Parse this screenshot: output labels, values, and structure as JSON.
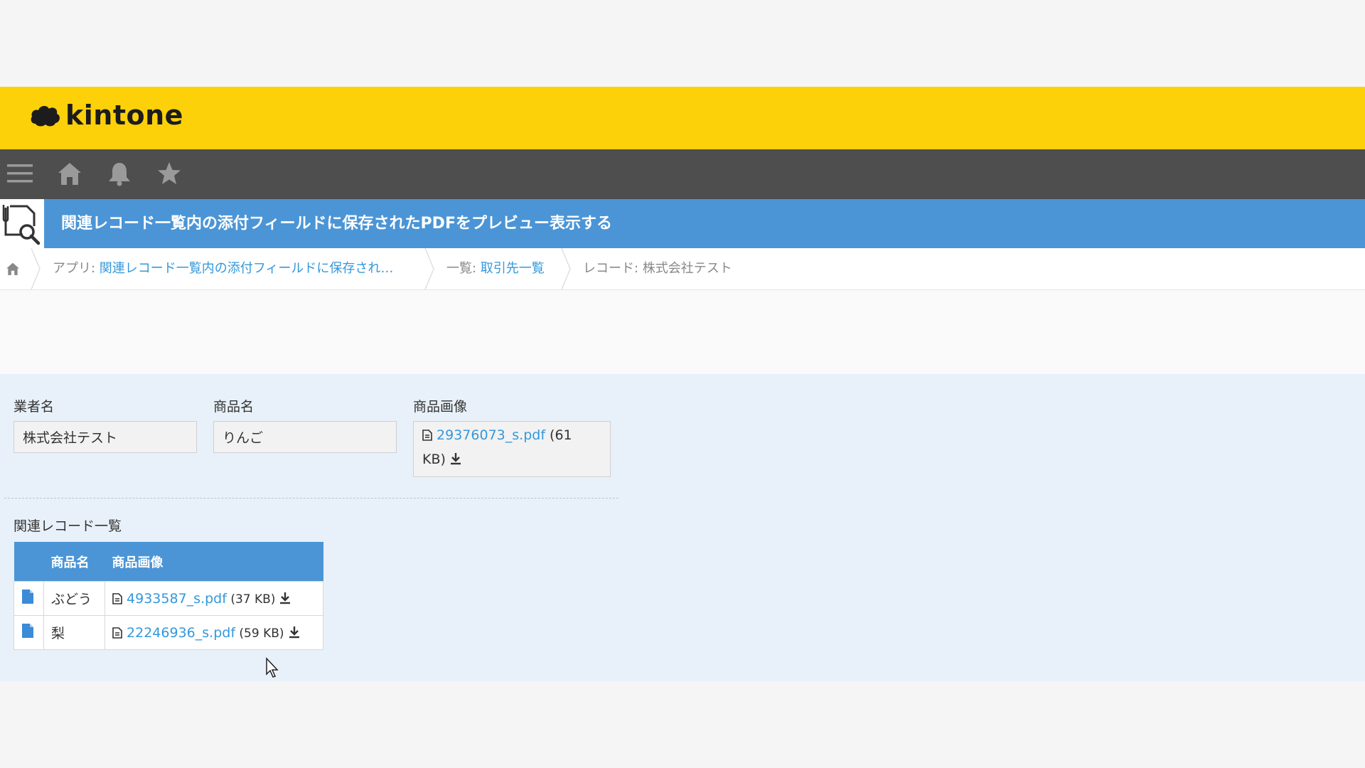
{
  "brand": {
    "name": "kintone",
    "logo_icon": "kintone-cloud-logo"
  },
  "nav": {
    "icons": [
      "menu-icon",
      "home-icon",
      "bell-icon",
      "star-icon"
    ]
  },
  "app": {
    "title": "関連レコード一覧内の添付フィールドに保存されたPDFをプレビュー表示する",
    "icon": "attachment-search-app-icon"
  },
  "breadcrumb": {
    "home_icon": "home-icon",
    "app_prefix": "アプリ: ",
    "app_name": "関連レコード一覧内の添付フィールドに保存され…",
    "list_prefix": "一覧: ",
    "list_name": "取引先一覧",
    "record_text": "レコード: 株式会社テスト"
  },
  "record": {
    "vendor": {
      "label": "業者名",
      "value": "株式会社テスト"
    },
    "product": {
      "label": "商品名",
      "value": "りんご"
    },
    "image": {
      "label": "商品画像",
      "file_name": "29376073_s.pdf",
      "size_open": " (61",
      "size_close": "KB)"
    }
  },
  "related": {
    "label": "関連レコード一覧",
    "columns": [
      "",
      "商品名",
      "商品画像"
    ],
    "rows": [
      {
        "name": "ぶどう",
        "file_name": "4933587_s.pdf",
        "size": " (37 KB)"
      },
      {
        "name": "梨",
        "file_name": "22246936_s.pdf",
        "size": " (59 KB)"
      }
    ]
  },
  "colors": {
    "header_yellow": "#fcd10a",
    "nav_gray": "#4e4e4e",
    "app_blue": "#4b95d6",
    "link_blue": "#3498db",
    "record_bg": "#e8f1f9"
  }
}
